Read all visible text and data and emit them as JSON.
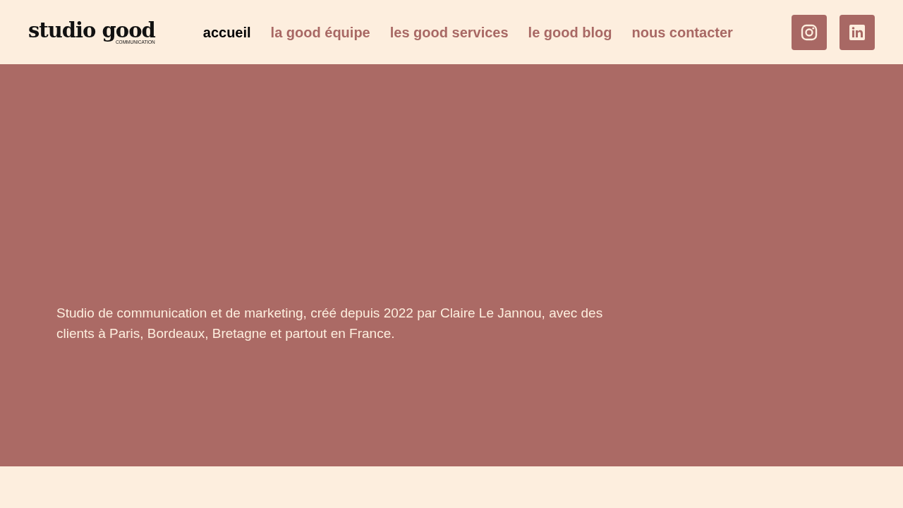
{
  "logo": {
    "title": "studio good",
    "subtitle": "COMMUNICATION"
  },
  "nav": [
    {
      "label": "accueil",
      "selected": true
    },
    {
      "label": "la good équipe",
      "selected": false
    },
    {
      "label": "les good services",
      "selected": false
    },
    {
      "label": "le good blog",
      "selected": false
    },
    {
      "label": "nous contacter",
      "selected": false
    }
  ],
  "social": [
    {
      "kind": "instagram"
    },
    {
      "kind": "linkedin"
    }
  ],
  "hero": {
    "text": "Studio de communication et de marketing, créé depuis 2022 par Claire Le Jannou, avec des clients à Paris, Bordeaux, Bretagne et partout en France."
  }
}
